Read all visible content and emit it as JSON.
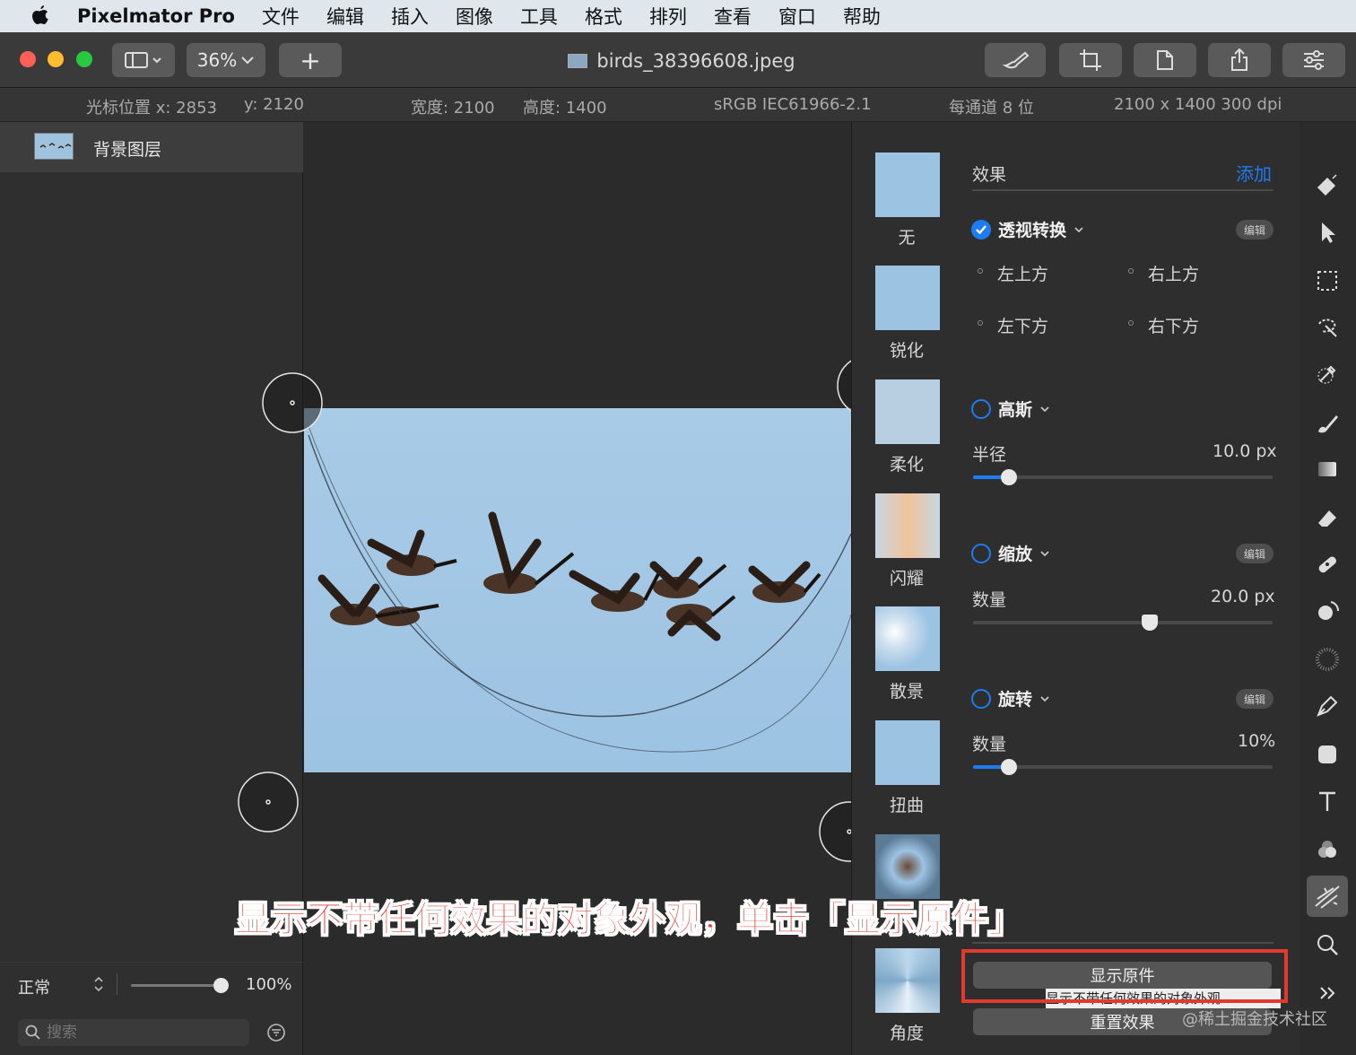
{
  "menubar": {
    "app_name": "Pixelmator Pro",
    "items": [
      "文件",
      "编辑",
      "插入",
      "图像",
      "工具",
      "格式",
      "排列",
      "查看",
      "窗口",
      "帮助"
    ]
  },
  "toolbar": {
    "zoom": "36%",
    "add_label": "+",
    "document_title": "birds_38396608.jpeg"
  },
  "infobar": {
    "cursor_x": "光标位置 x:  2853",
    "cursor_y": "y:  2120",
    "width": "宽度:  2100",
    "height": "高度:  1400",
    "color_profile": "sRGB IEC61966-2.1",
    "bit_depth": "每通道 8 位",
    "dimensions": "2100 x 1400 300 dpi"
  },
  "layers": {
    "items": [
      {
        "label": "背景图层"
      }
    ],
    "blend_mode": "正常",
    "opacity": "100%",
    "opacity_value": 1.0,
    "search_placeholder": "搜索"
  },
  "effect_thumbnails": [
    {
      "label": "无"
    },
    {
      "label": "锐化"
    },
    {
      "label": "柔化"
    },
    {
      "label": "闪耀"
    },
    {
      "label": "散景"
    },
    {
      "label": "扭曲"
    },
    {
      "label": ""
    },
    {
      "label": "角度"
    }
  ],
  "effects_panel": {
    "title": "效果",
    "add_label": "添加",
    "perspective": {
      "name": "透视转换",
      "enabled": true,
      "edit_label": "编辑",
      "points": [
        "左上方",
        "右上方",
        "左下方",
        "右下方"
      ]
    },
    "gaussian": {
      "name": "高斯",
      "enabled": false,
      "param_label": "半径",
      "param_value": "10.0 px",
      "slider_fraction": 0.12
    },
    "zoom": {
      "name": "缩放",
      "enabled": false,
      "edit_label": "编辑",
      "param_label": "数量",
      "param_value": "20.0 px",
      "slider_fraction": 0.59
    },
    "rotate": {
      "name": "旋转",
      "enabled": false,
      "edit_label": "编辑",
      "param_label": "数量",
      "param_value": "10%",
      "slider_fraction": 0.12
    },
    "show_original_label": "显示原件",
    "reset_label": "重置效果",
    "tooltip": "显示不带任何效果的对象外观"
  },
  "caption": "显示不带任何效果的对象外观，单击「显示原件」",
  "watermark": "@稀土掘金技术社区",
  "colors": {
    "accent": "#1e7cf2",
    "highlight": "#e23a2e"
  }
}
